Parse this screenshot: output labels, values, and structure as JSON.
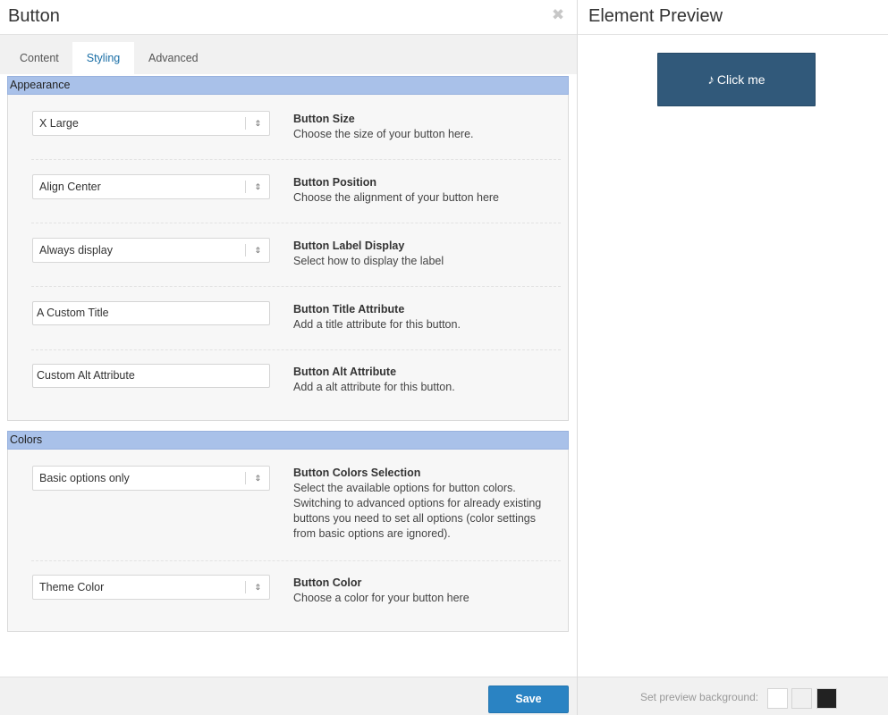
{
  "editor": {
    "title": "Button",
    "close_glyph": "✖",
    "tabs": [
      {
        "label": "Content",
        "active": false
      },
      {
        "label": "Styling",
        "active": true
      },
      {
        "label": "Advanced",
        "active": false
      }
    ],
    "sections": {
      "appearance": {
        "title": "Appearance",
        "rows": [
          {
            "control": "select",
            "value": "X Large",
            "label": "Button Size",
            "description": "Choose the size of your button here."
          },
          {
            "control": "select",
            "value": "Align Center",
            "label": "Button Position",
            "description": "Choose the alignment of your button here"
          },
          {
            "control": "select",
            "value": "Always display",
            "label": "Button Label Display",
            "description": "Select how to display the label"
          },
          {
            "control": "text",
            "value": "A Custom Title",
            "label": "Button Title Attribute",
            "description": "Add a title attribute for this button."
          },
          {
            "control": "text",
            "value": "Custom Alt Attribute",
            "label": "Button Alt Attribute",
            "description": "Add a alt attribute for this button."
          }
        ]
      },
      "colors": {
        "title": "Colors",
        "rows": [
          {
            "control": "select",
            "value": "Basic options only",
            "label": "Button Colors Selection",
            "description": "Select the available options for button colors. Switching to advanced options for already existing buttons you need to set all options (color settings from basic options are ignored)."
          },
          {
            "control": "select",
            "value": "Theme Color",
            "label": "Button Color",
            "description": "Choose a color for your button here"
          }
        ]
      }
    },
    "footer": {
      "save_label": "Save"
    }
  },
  "preview": {
    "title": "Element Preview",
    "button_icon": "♪",
    "button_label": "Click me",
    "background_label": "Set preview background:",
    "swatches": [
      "#ffffff",
      "#f0f0f0",
      "#222222"
    ]
  },
  "colors": {
    "section_header": "#a9c1e9",
    "save_button": "#2a83c3",
    "preview_button": "#31597a",
    "active_tab_text": "#1a6ea6"
  }
}
